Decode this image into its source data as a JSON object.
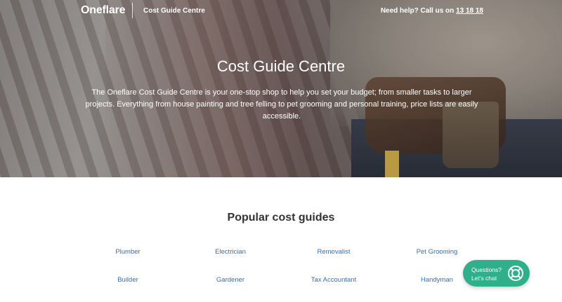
{
  "header": {
    "logo_text": "Oneflare",
    "section_label": "Cost Guide Centre",
    "help_prefix": "Need help? Call us on ",
    "help_phone": "13 18 18"
  },
  "hero": {
    "title": "Cost Guide Centre",
    "description": "The Oneflare Cost Guide Centre is your one-stop shop to help you set your budget; from smaller tasks to larger projects. Everything from house painting and tree felling to pet grooming and personal training, price lists are easily accessible."
  },
  "popular": {
    "title": "Popular cost guides",
    "row1": [
      "Plumber",
      "Electrician",
      "Removalist",
      "Pet Grooming"
    ],
    "row2": [
      "Builder",
      "Gardener",
      "Tax Accountant",
      "Handyman"
    ]
  },
  "chat": {
    "line1": "Questions?",
    "line2": "Let's chat",
    "icon": "lifebuoy-icon"
  },
  "colors": {
    "accent_green": "#2fb08a",
    "link_blue": "#2f6fc1"
  }
}
